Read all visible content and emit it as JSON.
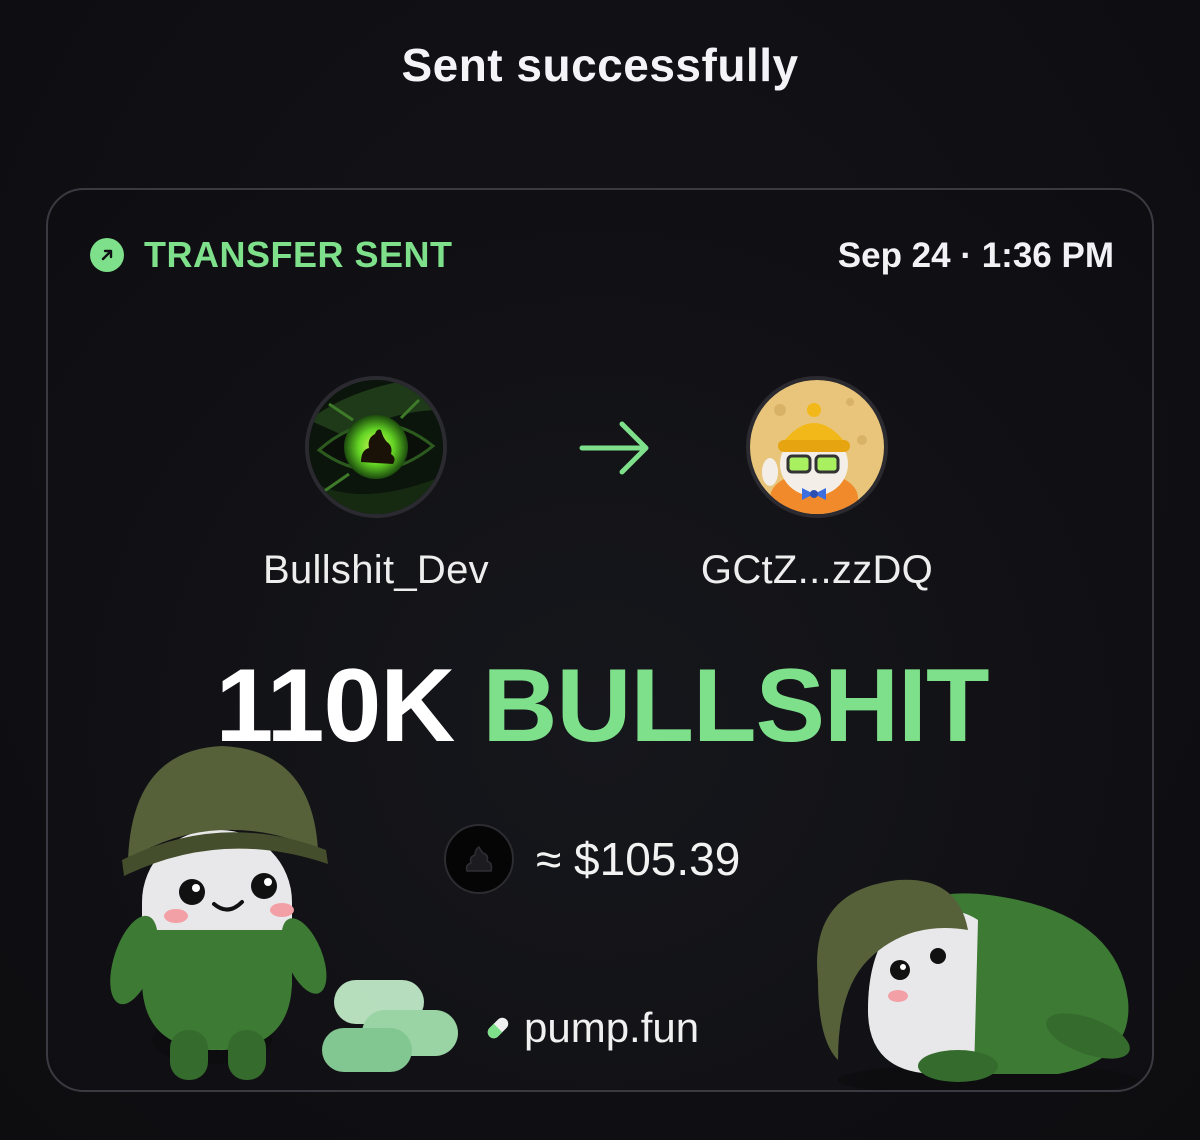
{
  "header": {
    "title": "Sent successfully"
  },
  "card": {
    "status": {
      "icon": "arrow-up-right-icon",
      "label": "TRANSFER SENT",
      "color": "#7ee08a"
    },
    "timestamp": "Sep 24 · 1:36 PM",
    "sender": {
      "name": "Bullshit_Dev",
      "avatar": "green-eye-avatar"
    },
    "recipient": {
      "name": "GCtZ...zzDQ",
      "avatar": "mascot-beanie-glasses-avatar"
    },
    "arrow_icon": "arrow-right-icon",
    "amount": {
      "quantity": "110K",
      "symbol": "BULLSHIT"
    },
    "value": {
      "token_icon": "poop-token-icon",
      "text": "≈ $105.39"
    },
    "brand": {
      "icon": "pill-icon",
      "text": "pump.fun"
    }
  },
  "colors": {
    "accent": "#7ee08a",
    "background": "#101014",
    "card_border": "#3a3b42"
  }
}
